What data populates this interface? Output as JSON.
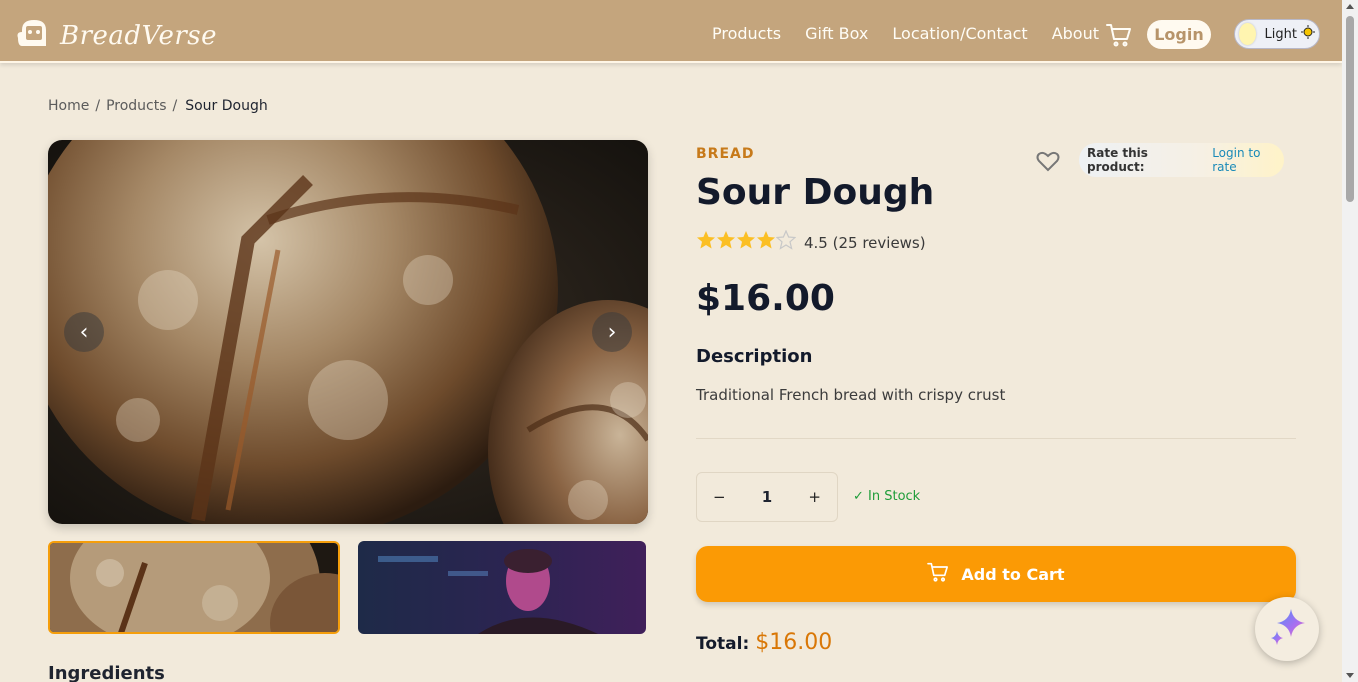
{
  "header": {
    "logo_text": "BreadVerse",
    "nav": [
      {
        "label": "Products"
      },
      {
        "label": "Gift Box"
      },
      {
        "label": "Location/Contact"
      },
      {
        "label": "About"
      }
    ],
    "login_label": "Login",
    "theme_label": "Light"
  },
  "breadcrumb": {
    "home": "Home",
    "products": "Products",
    "current": "Sour Dough",
    "separator": "/"
  },
  "gallery": {
    "prev": "‹",
    "next": "›"
  },
  "ingredients_heading": "Ingredients",
  "product": {
    "category": "BREAD",
    "title": "Sour Dough",
    "rating": 4.5,
    "rating_text": "4.5 (25 reviews)",
    "price": "$16.00",
    "description_heading": "Description",
    "description": "Traditional French bread with crispy crust",
    "rate_label": "Rate this product:",
    "rate_link": "Login to rate",
    "quantity": "1",
    "qty_minus": "−",
    "qty_plus": "+",
    "stock": "✓ In Stock",
    "add_to_cart": "Add to Cart",
    "total_label": "Total:",
    "total_value": "$16.00"
  },
  "colors": {
    "header_bg": "#c4a57d",
    "page_bg": "#f2eadb",
    "accent": "#fb9a05",
    "stock_green": "#1f9d3a",
    "star": "#fbbf24"
  }
}
